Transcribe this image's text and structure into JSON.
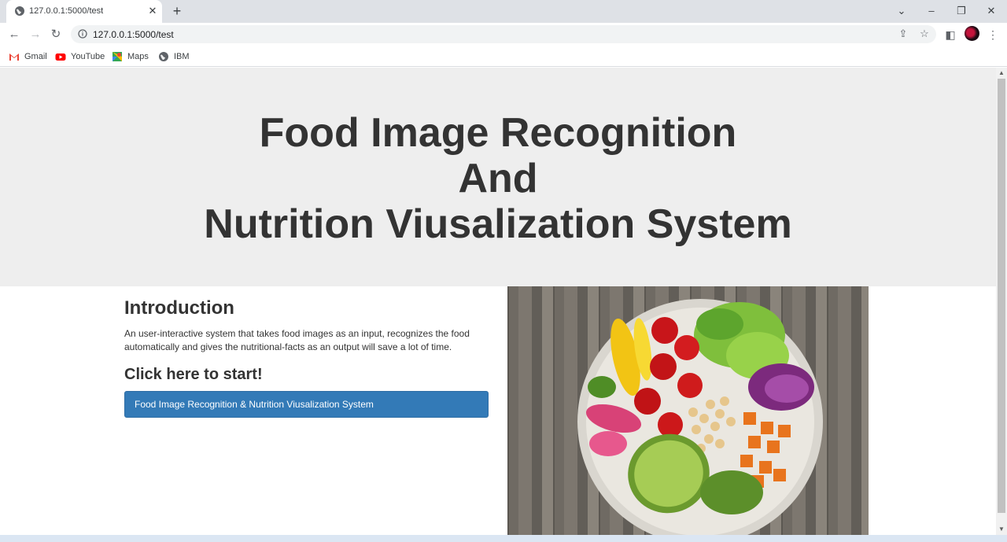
{
  "browser": {
    "tab_title": "127.0.0.1:5000/test",
    "url": "127.0.0.1:5000/test",
    "bookmarks": [
      {
        "label": "Gmail"
      },
      {
        "label": "YouTube"
      },
      {
        "label": "Maps"
      },
      {
        "label": "IBM"
      }
    ]
  },
  "hero": {
    "line1": "Food Image Recognition",
    "line2": "And",
    "line3": "Nutrition Viusalization System"
  },
  "intro": {
    "heading": "Introduction",
    "text": "An user-interactive system that takes food images as an input, recognizes the food automatically and gives the nutritional-facts as an output will save a lot of time."
  },
  "start": {
    "heading": "Click here to start!",
    "button_label": "Food Image Recognition & Nutrition Viusalization System"
  },
  "colors": {
    "hero_bg": "#eeeeee",
    "button_bg": "#337ab7",
    "text": "#333333"
  }
}
